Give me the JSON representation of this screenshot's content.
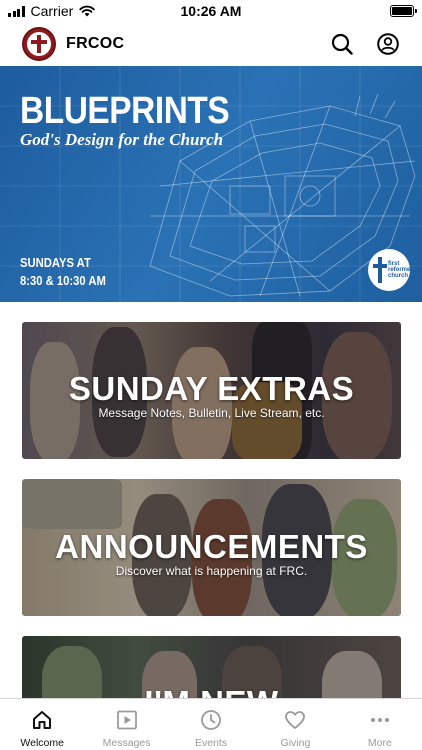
{
  "status_bar": {
    "carrier": "Carrier",
    "time": "10:26 AM"
  },
  "header": {
    "app_title": "FRCOC",
    "logo_icon": "church-cross-logo",
    "search_icon": "search-icon",
    "account_icon": "user-account-icon"
  },
  "hero": {
    "title": "BLUEPRINTS",
    "subtitle": "God's Design for the Church",
    "schedule_line1": "SUNDAYS AT",
    "schedule_line2": "8:30 & 10:30 AM",
    "badge_text": "first reformed church",
    "background_color": "#1d5c9e"
  },
  "cards": [
    {
      "title": "SUNDAY EXTRAS",
      "subtitle": "Message Notes, Bulletin, Live Stream, etc."
    },
    {
      "title": "ANNOUNCEMENTS",
      "subtitle": "Discover what is happening at FRC."
    },
    {
      "title": "I'M NEW",
      "subtitle": ""
    }
  ],
  "tabs": [
    {
      "label": "Welcome",
      "icon": "home-icon",
      "active": true
    },
    {
      "label": "Messages",
      "icon": "play-icon",
      "active": false
    },
    {
      "label": "Events",
      "icon": "clock-icon",
      "active": false
    },
    {
      "label": "Giving",
      "icon": "heart-icon",
      "active": false
    },
    {
      "label": "More",
      "icon": "more-dots-icon",
      "active": false
    }
  ],
  "colors": {
    "brand": "#8e1b1f",
    "tab_active": "#111111",
    "tab_inactive": "#9a9a9a"
  }
}
